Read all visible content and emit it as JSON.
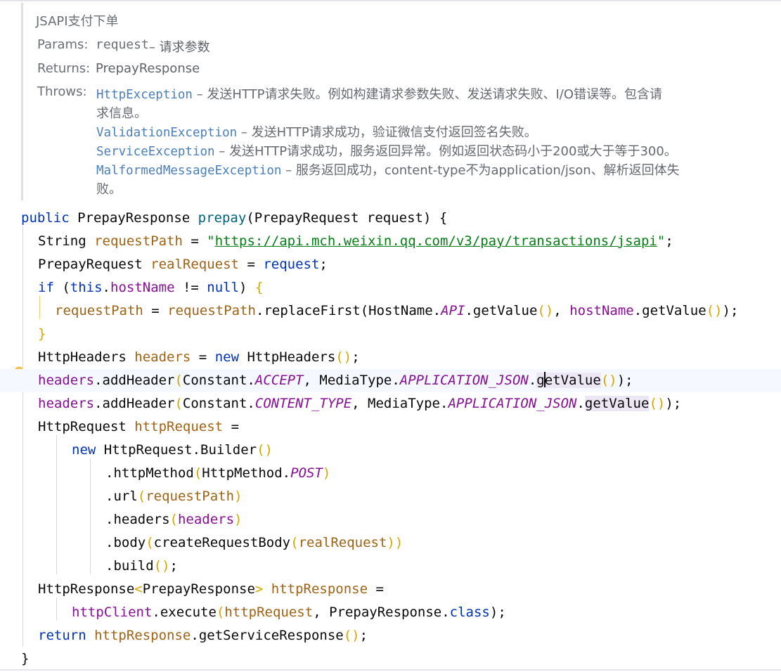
{
  "doc": {
    "title": "JSAPI支付下单",
    "params_label": "Params:",
    "params_name": "request",
    "params_desc": " – 请求参数",
    "returns_label": "Returns:",
    "returns_value": "PrepayResponse",
    "throws_label": "Throws:",
    "exceptions": [
      {
        "name": "HttpException",
        "desc": " – 发送HTTP请求失败。例如构建请求参数失败、发送请求失败、I/O错误等。包含请",
        "cont": "求信息。"
      },
      {
        "name": "ValidationException",
        "desc": " – 发送HTTP请求成功，验证微信支付返回签名失败。"
      },
      {
        "name": "ServiceException",
        "desc": " – 发送HTTP请求成功，服务返回异常。例如返回状态码小于200或大于等于300。"
      },
      {
        "name": "MalformedMessageException",
        "desc": " – 服务返回成功，content-type不为application/json、解析返回体失",
        "cont": "败。"
      }
    ]
  },
  "code": {
    "l1": {
      "public": "public",
      "rtype": " PrepayResponse ",
      "method": "prepay",
      "p_open": "(",
      "ptype": "PrepayRequest ",
      "pname": "request",
      "p_close": ") {"
    },
    "l2": {
      "type": "String ",
      "var": "requestPath",
      "eq": " = ",
      "q1": "\"",
      "url": "https://api.mch.weixin.qq.com/v3/pay/transactions/jsapi",
      "q2": "\"",
      "semi": ";"
    },
    "l3": {
      "type": "PrepayRequest ",
      "var": "realRequest",
      "eq": " = ",
      "val": "request",
      "semi": ";"
    },
    "l4": {
      "if": "if",
      "open": " (",
      "this": "this",
      "dot": ".",
      "field": "hostName",
      "ne": " != ",
      "null": "null",
      "close": ") ",
      "brace": "{"
    },
    "l5": {
      "var": "requestPath",
      "eq": " = ",
      "var2": "requestPath",
      "call": ".replaceFirst(HostName.",
      "const": "API",
      "gv": ".getValue",
      "p1": "()",
      "comma": ", ",
      "field": "hostName",
      "gv2": ".getValue",
      "p2": "()",
      "end": ");"
    },
    "l6": {
      "brace": "}"
    },
    "l7": {
      "type": "HttpHeaders ",
      "var": "headers",
      "eq": " = ",
      "new": "new",
      "ctor": " HttpHeaders",
      "par": "()",
      "semi": ";"
    },
    "l8": {
      "var": "headers",
      "call": ".addHeader",
      "open": "(",
      "cls": "Constant.",
      "const": "ACCEPT",
      "comma": ", MediaType.",
      "const2": "APPLICATION_JSON",
      "dot": ".",
      "g1": "g",
      "g2": "etValue",
      "par": "()",
      "end": ");"
    },
    "l9": {
      "var": "headers",
      "call": ".addHeader",
      "open": "(",
      "cls": "Constant.",
      "const": "CONTENT_TYPE",
      "comma": ", MediaType.",
      "const2": "APPLICATION_JSON",
      "dot": ".",
      "gv": "getValue",
      "par": "()",
      "end": ");"
    },
    "l10": {
      "type": "HttpRequest ",
      "var": "httpRequest",
      "eq": " ="
    },
    "l11": {
      "new": "new",
      "ctor": " HttpRequest.Builder",
      "par": "()"
    },
    "l12": {
      "call": ".httpMethod",
      "open": "(",
      "cls": "HttpMethod.",
      "const": "POST",
      "close": ")"
    },
    "l13": {
      "call": ".url",
      "open": "(",
      "arg": "requestPath",
      "close": ")"
    },
    "l14": {
      "call": ".headers",
      "open": "(",
      "arg": "headers",
      "close": ")"
    },
    "l15": {
      "call": ".body",
      "open": "(",
      "inner": "createRequestBody",
      "open2": "(",
      "arg": "realRequest",
      "close2": ")",
      "close": ")"
    },
    "l16": {
      "call": ".build",
      "par": "()",
      "semi": ";"
    },
    "l17": {
      "type": "HttpResponse",
      "lt": "<",
      "gen": "PrepayResponse",
      "gt": ">",
      "sp": " ",
      "var": "httpResponse",
      "eq": " ="
    },
    "l18": {
      "var": "httpClient",
      "call": ".execute",
      "open": "(",
      "arg": "httpRequest",
      "comma": ", PrepayResponse.",
      "class": "class",
      "close": ");"
    },
    "l19": {
      "return": "return",
      "sp": " ",
      "var": "httpResponse",
      "call": ".getServiceResponse",
      "par": "()",
      "semi": ";"
    },
    "l20": {
      "brace": "}"
    }
  },
  "colors": {
    "keyword": "#0033b3",
    "string": "#067d17",
    "field": "#871094",
    "local": "#9e6314",
    "exception_link": "#4a7fba",
    "doc_text": "#66696f"
  },
  "icons": {
    "gutter": "lightbulb-icon"
  }
}
